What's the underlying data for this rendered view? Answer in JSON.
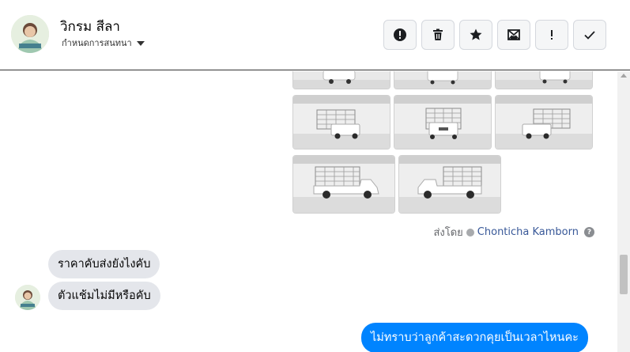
{
  "header": {
    "user_name": "วิกรม สีลา",
    "conversation_setting": "กำหนดการสนทนา",
    "actions": [
      {
        "name": "mark-spam",
        "icon": "exclamation-circle-icon"
      },
      {
        "name": "delete",
        "icon": "trash-icon"
      },
      {
        "name": "star",
        "icon": "star-icon"
      },
      {
        "name": "mark-unread",
        "icon": "envelope-icon"
      },
      {
        "name": "mark-important",
        "icon": "exclamation-icon"
      },
      {
        "name": "mark-done",
        "icon": "check-icon"
      }
    ]
  },
  "thread": {
    "photo_count": 8,
    "sent_by_label": "ส่งโดย",
    "sender_name": "Chonticha Kamborn",
    "help_glyph": "?",
    "incoming_messages": [
      "ราคาคับส่งยังไงคับ",
      "ตัวแช้มไม่มีหรือคับ"
    ],
    "outgoing_messages": [
      "ไม่ทราบว่าลูกค้าสะดวกคุยเป็นเวลาไหนคะ"
    ]
  },
  "colors": {
    "accent": "#0084ff",
    "incoming_bubble": "#e4e6eb",
    "link": "#385898"
  }
}
